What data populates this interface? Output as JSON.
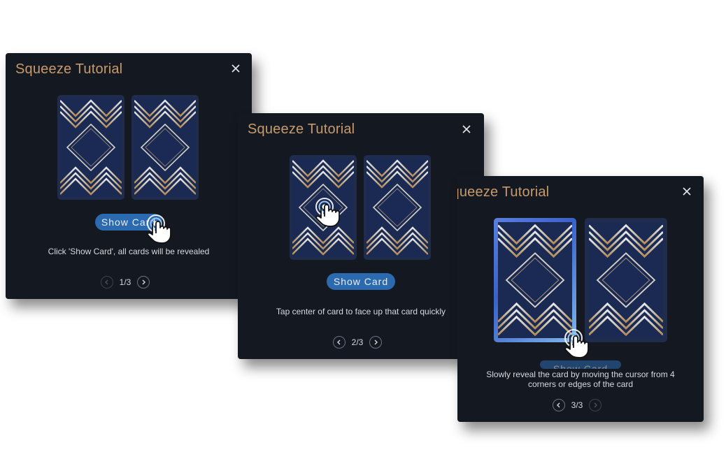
{
  "tutorial": {
    "title": "Squeeze Tutorial",
    "button_label": "Show Card",
    "colors": {
      "panel": "#141820",
      "title": "#c79a6b",
      "button": "#2c6ab0",
      "card": "#1f2c4c"
    }
  },
  "panels": [
    {
      "description": "Click 'Show Card', all cards will be revealed",
      "page": "1/3"
    },
    {
      "description": "Tap center of card to face up that card quickly",
      "page": "2/3"
    },
    {
      "description_line1": "Slowly reveal the card by moving the cursor from 4",
      "description_line2": "corners or edges of the card",
      "page": "3/3"
    }
  ],
  "icons": [
    "close-icon",
    "chevron-left-icon",
    "chevron-right-icon",
    "tap-hand-icon",
    "card-back-pattern"
  ]
}
